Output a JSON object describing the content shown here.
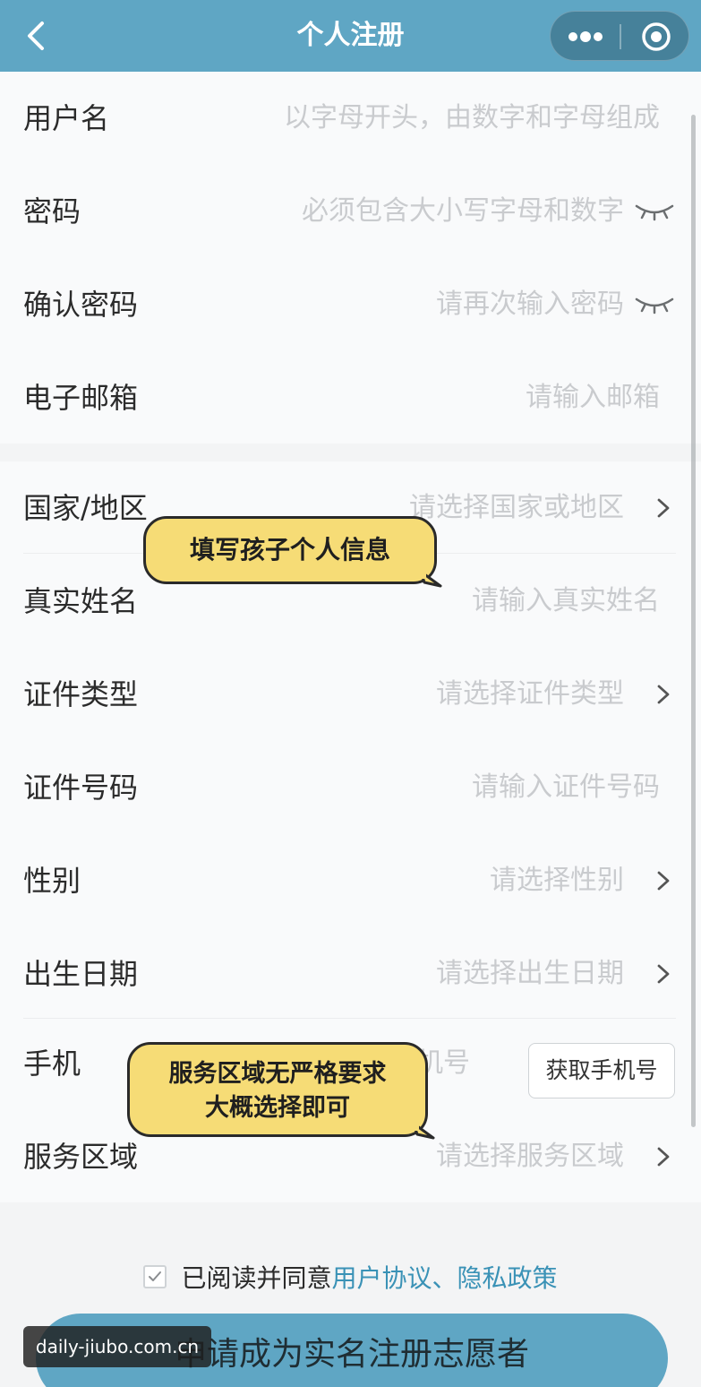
{
  "nav": {
    "title": "个人注册",
    "back_icon": "chevron-left-icon",
    "more_icon": "more-dots-icon",
    "close_icon": "target-close-icon"
  },
  "account_section": {
    "rows": [
      {
        "label": "用户名",
        "placeholder": "以字母开头，由数字和字母组成"
      },
      {
        "label": "密码",
        "placeholder": "必须包含大小写字母和数字",
        "icon": "eye-closed-icon"
      },
      {
        "label": "确认密码",
        "placeholder": "请再次输入密码",
        "icon": "eye-closed-icon"
      },
      {
        "label": "电子邮箱",
        "placeholder": "请输入邮箱"
      }
    ]
  },
  "personal_section": {
    "rows": [
      {
        "label": "国家/地区",
        "placeholder": "请选择国家或地区",
        "icon": "chevron-right-icon"
      },
      {
        "label": "真实姓名",
        "placeholder": "请输入真实姓名"
      },
      {
        "label": "证件类型",
        "placeholder": "请选择证件类型",
        "icon": "chevron-right-icon"
      },
      {
        "label": "证件号码",
        "placeholder": "请输入证件号码"
      },
      {
        "label": "性别",
        "placeholder": "请选择性别",
        "icon": "chevron-right-icon"
      },
      {
        "label": "出生日期",
        "placeholder": "请选择出生日期",
        "icon": "chevron-right-icon"
      },
      {
        "label": "手机",
        "placeholder": "机号",
        "button": "获取手机号"
      },
      {
        "label": "服务区域",
        "placeholder": "请选择服务区域",
        "icon": "chevron-right-icon"
      }
    ]
  },
  "annotations": {
    "bubble_1": "填写孩子个人信息",
    "bubble_2_line1": "服务区域无严格要求",
    "bubble_2_line2": "大概选择即可"
  },
  "agreement": {
    "prefix": "已阅读并同意",
    "link": "用户协议、隐私政策",
    "checked": true
  },
  "submit": {
    "label": "申请成为实名注册志愿者"
  },
  "watermark": "daily-jiubo.com.cn",
  "colors": {
    "nav_background": "#5fa6c4",
    "link": "#3a92b6",
    "bubble": "#f6dc76",
    "placeholder": "#c9cbce"
  }
}
